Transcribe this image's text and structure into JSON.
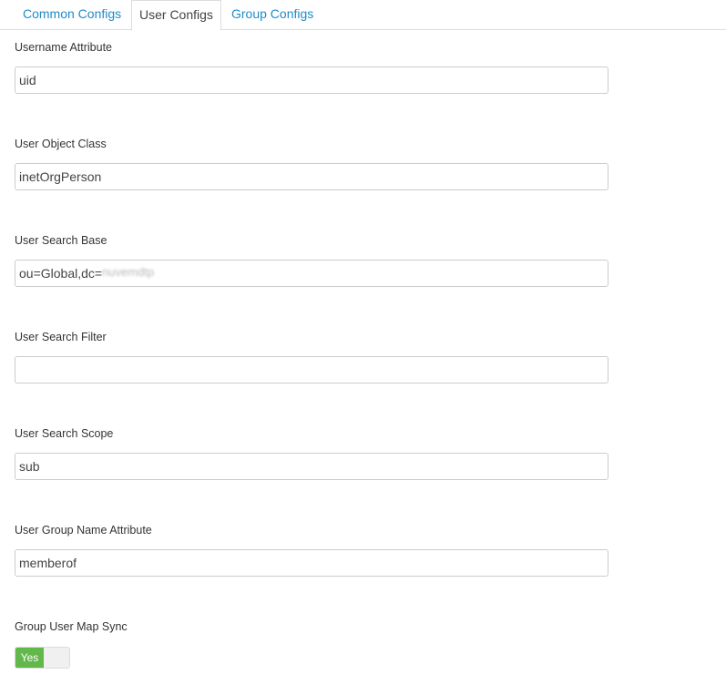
{
  "tabs": {
    "common": "Common Configs",
    "user": "User Configs",
    "group": "Group Configs",
    "active": "User Configs"
  },
  "fields": {
    "username_attribute": {
      "label": "Username Attribute",
      "value": "uid"
    },
    "user_object_class": {
      "label": "User Object Class",
      "value": "inetOrgPerson"
    },
    "user_search_base": {
      "label": "User Search Base",
      "value": "ou=Global,dc=",
      "redacted_suffix": "nuvemdtp"
    },
    "user_search_filter": {
      "label": "User Search Filter",
      "value": ""
    },
    "user_search_scope": {
      "label": "User Search Scope",
      "value": "sub"
    },
    "user_group_name_attribute": {
      "label": "User Group Name Attribute",
      "value": "memberof"
    }
  },
  "group_user_map_sync": {
    "label": "Group User Map Sync",
    "toggle_label": "Yes",
    "enabled": true
  },
  "colors": {
    "link": "#1f8bc7",
    "toggle_on": "#62b84a",
    "border": "#cccccc"
  }
}
